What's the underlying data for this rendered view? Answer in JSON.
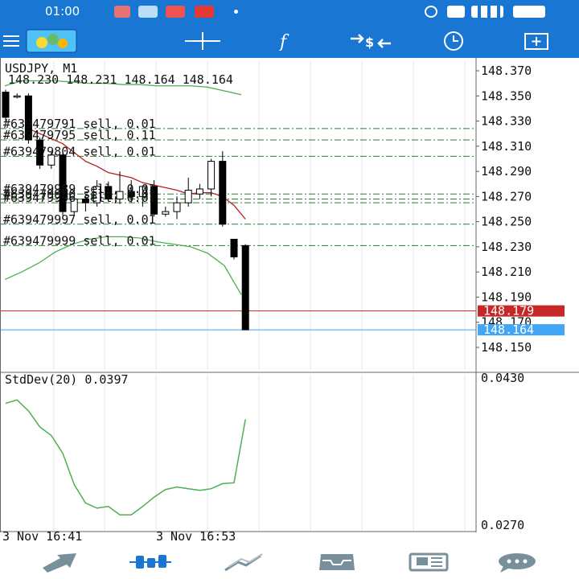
{
  "status_bar": {
    "time": "01:00"
  },
  "chart": {
    "symbol_title": "USDJPY, M1",
    "ohlc_line": "148.230 148.231 148.164 148.164",
    "price_labels": [
      "148.370",
      "148.350",
      "148.330",
      "148.310",
      "148.290",
      "148.270",
      "148.250",
      "148.230",
      "148.210",
      "148.190",
      "148.170",
      "148.150"
    ],
    "bid_label": "148.179",
    "ask_label": "148.164",
    "orders": [
      "#639479791 sell, 0.01",
      "#639479795 sell, 0.11",
      "#639479804 sell, 0.01",
      "#639479989 sell, 0.01",
      "#639479990 sell, 0.01",
      "#639479996 sell, 0.01",
      "#639479997 sell, 0.01",
      "#639479999 sell, 0.01"
    ],
    "indicator_title": "StdDev(20) 0.0397",
    "indicator_labels": [
      "0.0430",
      "0.0270"
    ],
    "time_labels": [
      "3 Nov 16:41",
      "3 Nov 16:53"
    ],
    "colors": {
      "bid_line": "#c62828",
      "ask_line": "#42a5f5",
      "order_line": "#2e7d32",
      "band": "#4caf50",
      "ma": "#b71c1c",
      "toolbar": "#1976d2"
    }
  },
  "chart_data": {
    "type": "candlestick",
    "title": "USDJPY, M1",
    "ylim": [
      148.14,
      148.38
    ],
    "candles": [
      {
        "o": 148.353,
        "h": 148.355,
        "l": 148.33,
        "c": 148.333
      },
      {
        "o": 148.35,
        "h": 148.352,
        "l": 148.348,
        "c": 148.35
      },
      {
        "o": 148.35,
        "h": 148.352,
        "l": 148.312,
        "c": 148.315
      },
      {
        "o": 148.315,
        "h": 148.317,
        "l": 148.292,
        "c": 148.295
      },
      {
        "o": 148.295,
        "h": 148.306,
        "l": 148.292,
        "c": 148.303
      },
      {
        "o": 148.303,
        "h": 148.305,
        "l": 148.255,
        "c": 148.258
      },
      {
        "o": 148.258,
        "h": 148.27,
        "l": 148.255,
        "c": 148.268
      },
      {
        "o": 148.268,
        "h": 148.27,
        "l": 148.258,
        "c": 148.265
      },
      {
        "o": 148.265,
        "h": 148.283,
        "l": 148.262,
        "c": 148.278
      },
      {
        "o": 148.278,
        "h": 148.282,
        "l": 148.266,
        "c": 148.268
      },
      {
        "o": 148.268,
        "h": 148.29,
        "l": 148.264,
        "c": 148.274
      },
      {
        "o": 148.274,
        "h": 148.283,
        "l": 148.265,
        "c": 148.27
      },
      {
        "o": 148.27,
        "h": 148.278,
        "l": 148.262,
        "c": 148.278
      },
      {
        "o": 148.278,
        "h": 148.283,
        "l": 148.254,
        "c": 148.256
      },
      {
        "o": 148.256,
        "h": 148.262,
        "l": 148.254,
        "c": 148.258
      },
      {
        "o": 148.258,
        "h": 148.27,
        "l": 148.252,
        "c": 148.265
      },
      {
        "o": 148.265,
        "h": 148.285,
        "l": 148.262,
        "c": 148.275
      },
      {
        "o": 148.272,
        "h": 148.28,
        "l": 148.268,
        "c": 148.276
      },
      {
        "o": 148.276,
        "h": 148.3,
        "l": 148.27,
        "c": 148.298
      },
      {
        "o": 148.298,
        "h": 148.306,
        "l": 148.246,
        "c": 148.248
      },
      {
        "o": 148.236,
        "h": 148.236,
        "l": 148.22,
        "c": 148.222
      },
      {
        "o": 148.231,
        "h": 148.232,
        "l": 148.164,
        "c": 148.164
      }
    ],
    "bid": 148.179,
    "ask": 148.164,
    "order_levels": [
      148.324,
      148.315,
      148.302,
      148.272,
      148.268,
      148.265,
      148.248,
      148.231
    ],
    "upper_band": [
      148.358,
      148.362,
      148.362,
      148.362,
      148.361,
      148.36,
      148.36,
      148.359,
      148.359,
      148.358,
      148.358,
      148.358,
      148.357,
      148.354,
      148.351
    ],
    "lower_band": [
      148.204,
      148.21,
      148.217,
      148.226,
      148.232,
      148.236,
      148.238,
      148.238,
      148.237,
      148.234,
      148.232,
      148.23,
      148.225,
      148.215,
      148.192
    ],
    "band_x": [
      0,
      1,
      2,
      3,
      4,
      5,
      6,
      7,
      8,
      9,
      10,
      11,
      12,
      13,
      14
    ],
    "ma_x": [
      2,
      3,
      4,
      5,
      6,
      7,
      8,
      9,
      10,
      11,
      12,
      13,
      14,
      15,
      16,
      17,
      18,
      19,
      20,
      21
    ],
    "ma": [
      148.324,
      148.32,
      148.316,
      148.312,
      148.305,
      148.298,
      148.294,
      148.289,
      148.287,
      148.285,
      148.281,
      148.279,
      148.277,
      148.275,
      148.272,
      148.273,
      148.273,
      148.27,
      148.263,
      148.252
    ],
    "stddev": {
      "name": "StdDev(20)",
      "ylim": [
        0.0262,
        0.0438
      ],
      "values": [
        0.0408,
        0.0412,
        0.0399,
        0.038,
        0.037,
        0.0349,
        0.0312,
        0.029,
        0.0284,
        0.0286,
        0.0276,
        0.0276,
        0.0286,
        0.0297,
        0.0306,
        0.0309,
        0.0307,
        0.0305,
        0.0307,
        0.0313,
        0.0314,
        0.0389
      ]
    }
  }
}
